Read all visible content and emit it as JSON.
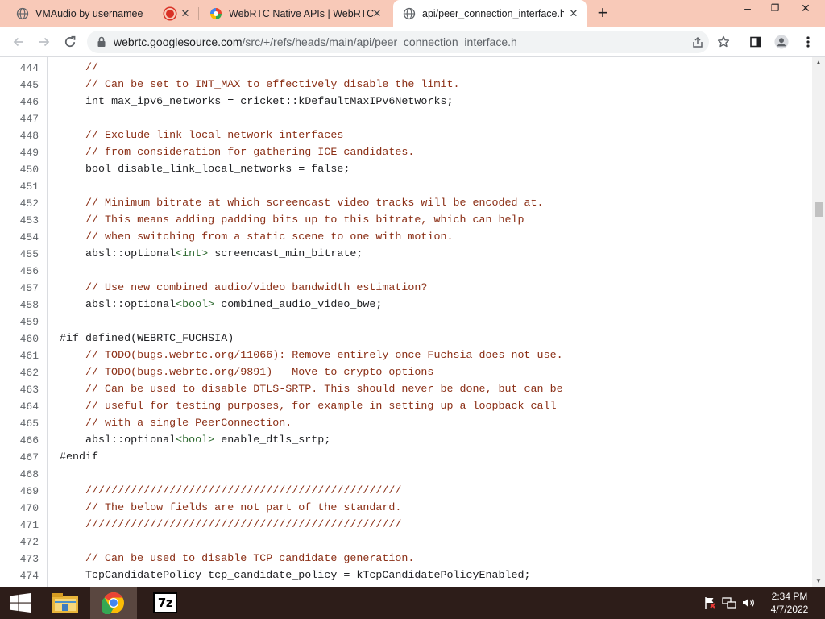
{
  "tabs": [
    {
      "title": "VMAudio by usernamee",
      "icon": "globe-icon",
      "recording": true
    },
    {
      "title": "WebRTC Native APIs | WebRTC",
      "icon": "webrtc-icon",
      "recording": false
    },
    {
      "title": "api/peer_connection_interface.h",
      "icon": "globe-icon",
      "recording": false,
      "active": true
    }
  ],
  "window_controls": {
    "minimize": "–",
    "restore": "❐",
    "close": "✕"
  },
  "address_bar": {
    "host": "webrtc.googlesource.com",
    "path": "/src/+/refs/heads/main/api/peer_connection_interface.h"
  },
  "code_lines": [
    {
      "n": "444",
      "html": "    <span class='cm'>//</span>"
    },
    {
      "n": "445",
      "html": "    <span class='cm'>// Can be set to INT_MAX to effectively disable the limit.</span>"
    },
    {
      "n": "446",
      "html": "    <span class='kw'>int</span> max_ipv6_networks = cricket::kDefaultMaxIPv6Networks;"
    },
    {
      "n": "447",
      "html": ""
    },
    {
      "n": "448",
      "html": "    <span class='cm'>// Exclude link-local network interfaces</span>"
    },
    {
      "n": "449",
      "html": "    <span class='cm'>// from consideration for gathering ICE candidates.</span>"
    },
    {
      "n": "450",
      "html": "    <span class='kw'>bool</span> disable_link_local_networks = <span class='kw'>false</span>;"
    },
    {
      "n": "451",
      "html": ""
    },
    {
      "n": "452",
      "html": "    <span class='cm'>// Minimum bitrate at which screencast video tracks will be encoded at.</span>"
    },
    {
      "n": "453",
      "html": "    <span class='cm'>// This means adding padding bits up to this bitrate, which can help</span>"
    },
    {
      "n": "454",
      "html": "    <span class='cm'>// when switching from a static scene to one with motion.</span>"
    },
    {
      "n": "455",
      "html": "    absl::optional<span class='ty'>&lt;int&gt;</span> screencast_min_bitrate;"
    },
    {
      "n": "456",
      "html": ""
    },
    {
      "n": "457",
      "html": "    <span class='cm'>// Use new combined audio/video bandwidth estimation?</span>"
    },
    {
      "n": "458",
      "html": "    absl::optional<span class='ty'>&lt;bool&gt;</span> combined_audio_video_bwe;"
    },
    {
      "n": "459",
      "html": ""
    },
    {
      "n": "460",
      "html": "<span class='pp'>#if defined(WEBRTC_FUCHSIA)</span>"
    },
    {
      "n": "461",
      "html": "    <span class='cm'>// TODO(bugs.webrtc.org/11066): Remove entirely once Fuchsia does not use.</span>"
    },
    {
      "n": "462",
      "html": "    <span class='cm'>// TODO(bugs.webrtc.org/9891) - Move to crypto_options</span>"
    },
    {
      "n": "463",
      "html": "    <span class='cm'>// Can be used to disable DTLS-SRTP. This should never be done, but can be</span>"
    },
    {
      "n": "464",
      "html": "    <span class='cm'>// useful for testing purposes, for example in setting up a loopback call</span>"
    },
    {
      "n": "465",
      "html": "    <span class='cm'>// with a single PeerConnection.</span>"
    },
    {
      "n": "466",
      "html": "    absl::optional<span class='ty'>&lt;bool&gt;</span> enable_dtls_srtp;"
    },
    {
      "n": "467",
      "html": "<span class='pp'>#endif</span>"
    },
    {
      "n": "468",
      "html": ""
    },
    {
      "n": "469",
      "html": "    <span class='cm'>/////////////////////////////////////////////////</span>"
    },
    {
      "n": "470",
      "html": "    <span class='cm'>// The below fields are not part of the standard.</span>"
    },
    {
      "n": "471",
      "html": "    <span class='cm'>/////////////////////////////////////////////////</span>"
    },
    {
      "n": "472",
      "html": ""
    },
    {
      "n": "473",
      "html": "    <span class='cm'>// Can be used to disable TCP candidate generation.</span>"
    },
    {
      "n": "474",
      "html": "    TcpCandidatePolicy tcp_candidate_policy = kTcpCandidatePolicyEnabled;"
    }
  ],
  "taskbar": {
    "apps": [
      "file-explorer-icon",
      "chrome-icon",
      "7zip-icon"
    ],
    "sevenzip_label": "7z",
    "time": "2:34 PM",
    "date": "4/7/2022"
  },
  "colors": {
    "tabstrip": "#f8c9b8",
    "taskbar": "#2d1d19",
    "comment": "#8b2f16",
    "type": "#2f6b31"
  }
}
